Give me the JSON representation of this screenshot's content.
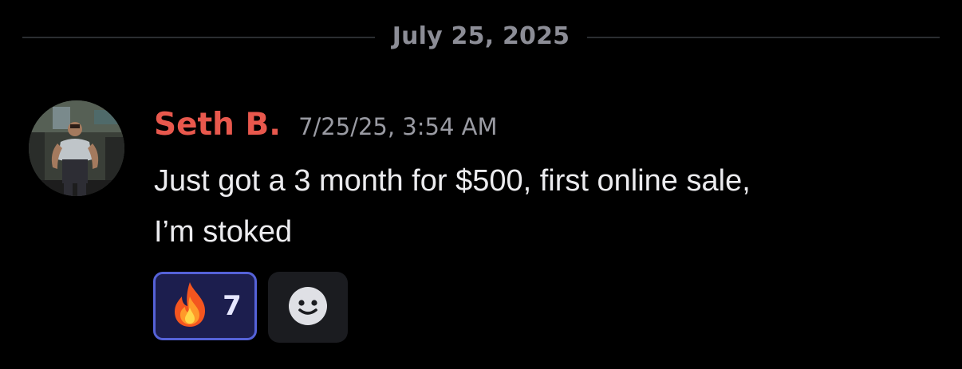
{
  "divider": {
    "date": "July 25, 2025"
  },
  "message": {
    "author": "Seth B.",
    "author_color": "#e8584d",
    "timestamp": "7/25/25, 3:54 AM",
    "text_line1": "Just got a 3 month for $500, first online sale,",
    "text_line2": "I’m stoked"
  },
  "reactions": [
    {
      "emoji": "fire-icon",
      "count": "7",
      "active": true,
      "accent": "#5562d8"
    }
  ],
  "add_reaction": {
    "icon": "smiley-icon"
  }
}
